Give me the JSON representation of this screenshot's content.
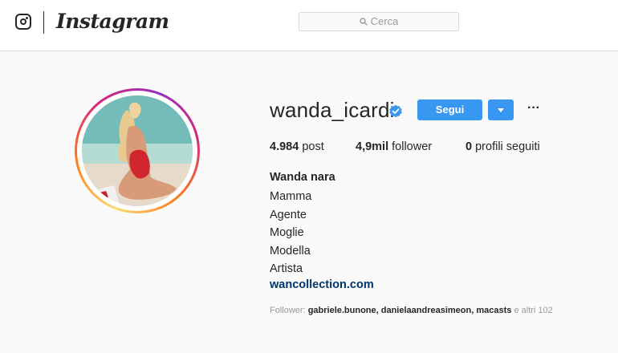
{
  "header": {
    "brand": "Instagram",
    "search": {
      "placeholder": "Cerca"
    }
  },
  "profile": {
    "username": "wanda_icardi",
    "verified": true,
    "follow_label": "Segui",
    "more_label": "···",
    "stats": [
      {
        "value": "4.984",
        "label": "post"
      },
      {
        "value": "4,9mil",
        "label": "follower"
      },
      {
        "value": "0",
        "label": "profili seguiti"
      }
    ],
    "full_name": "Wanda nara",
    "bio_lines": [
      "Mamma",
      "Agente",
      "Moglie",
      "Modella",
      "Artista"
    ],
    "website": "wancollection.com",
    "followed_by": {
      "prefix": "Follower:",
      "names": "gabriele.bunone, danielaandreasimeon, macasts",
      "suffix": "e altri 102"
    }
  },
  "colors": {
    "follow_button": "#3897f0",
    "verified_badge": "#3897f0",
    "link": "#003569"
  }
}
